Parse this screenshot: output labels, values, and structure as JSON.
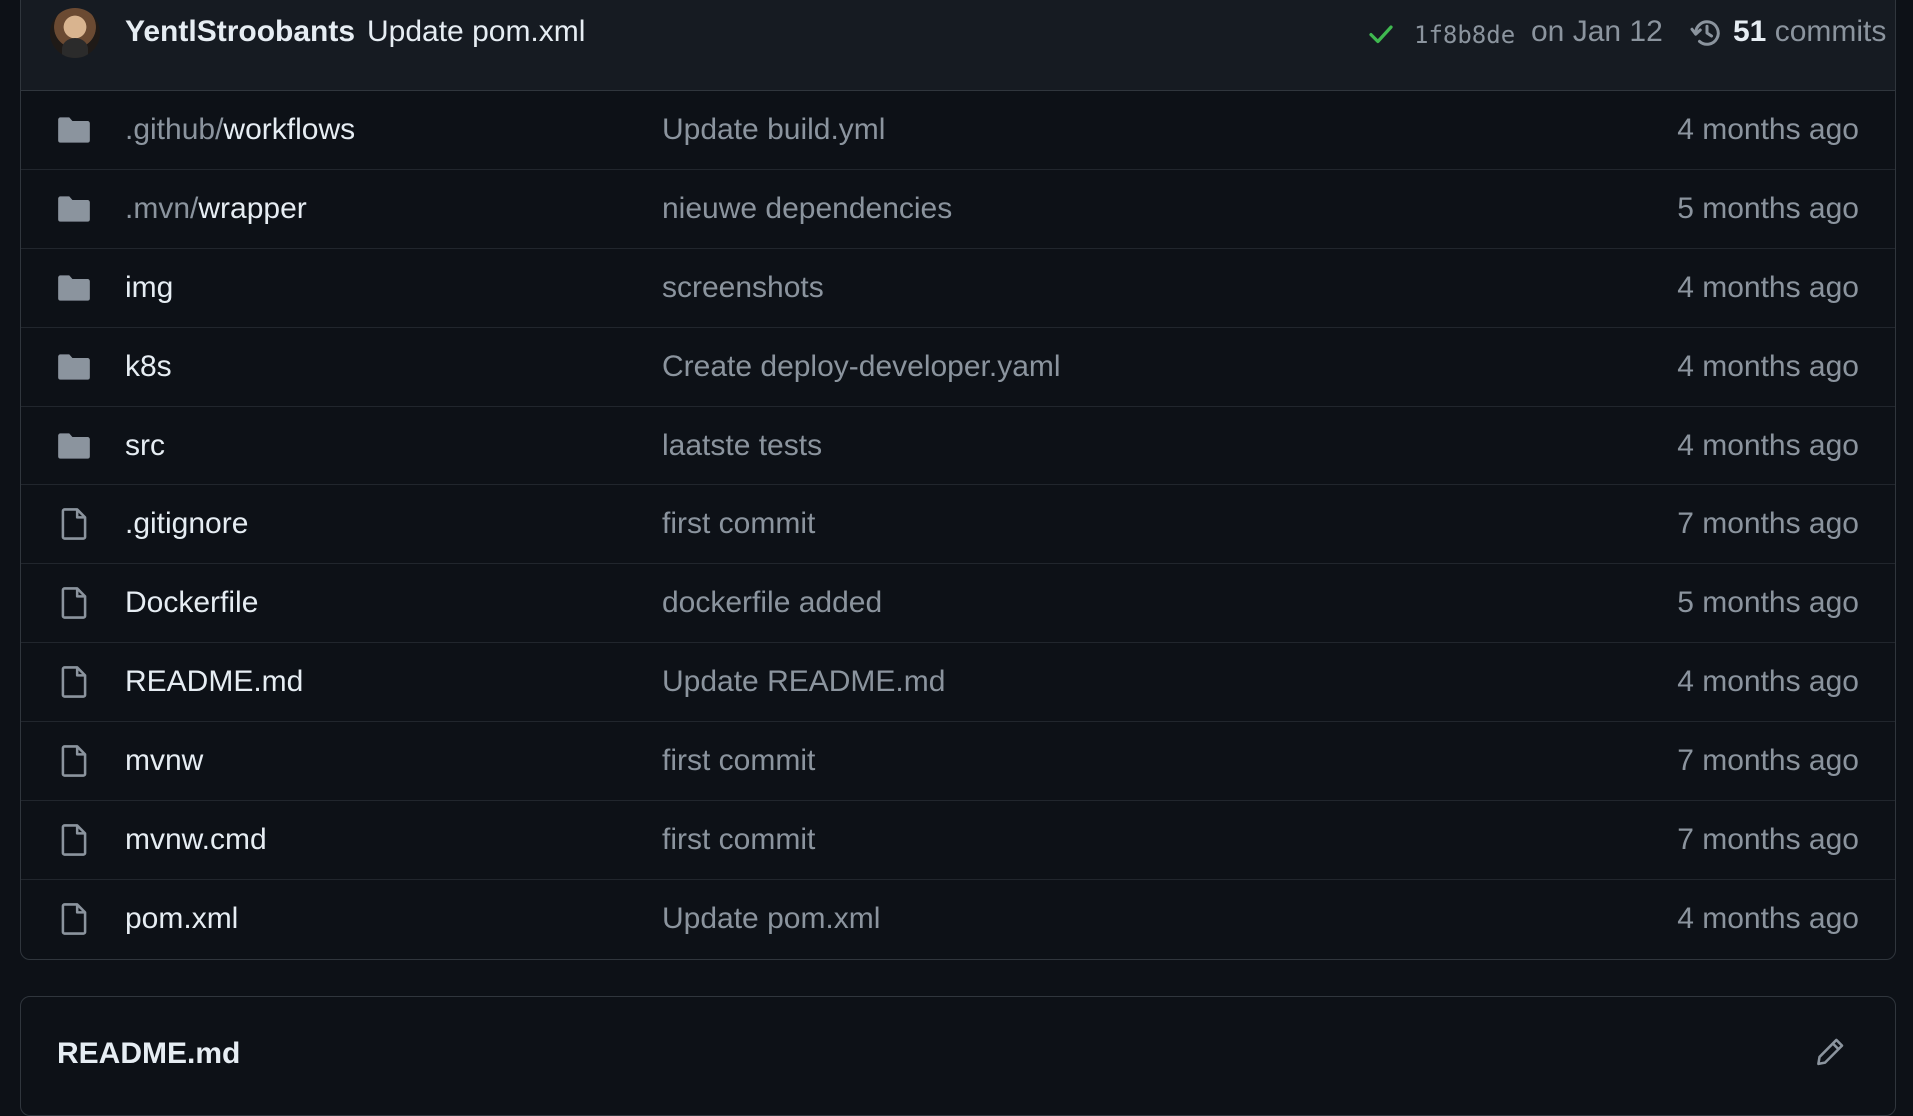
{
  "commit": {
    "author": "YentlStroobants",
    "message": "Update pom.xml",
    "status_icon": "check-icon",
    "sha": "1f8b8de",
    "date": "on Jan 12",
    "history_icon": "history-icon",
    "count": "51",
    "count_label": "commits"
  },
  "files": [
    {
      "type": "folder",
      "prefix": ".github/",
      "name": "workflows",
      "message": "Update build.yml",
      "age": "4 months ago"
    },
    {
      "type": "folder",
      "prefix": ".mvn/",
      "name": "wrapper",
      "message": "nieuwe dependencies",
      "age": "5 months ago"
    },
    {
      "type": "folder",
      "prefix": "",
      "name": "img",
      "message": "screenshots",
      "age": "4 months ago"
    },
    {
      "type": "folder",
      "prefix": "",
      "name": "k8s",
      "message": "Create deploy-developer.yaml",
      "age": "4 months ago"
    },
    {
      "type": "folder",
      "prefix": "",
      "name": "src",
      "message": "laatste tests",
      "age": "4 months ago"
    },
    {
      "type": "file",
      "prefix": "",
      "name": ".gitignore",
      "message": "first commit",
      "age": "7 months ago"
    },
    {
      "type": "file",
      "prefix": "",
      "name": "Dockerfile",
      "message": "dockerfile added",
      "age": "5 months ago"
    },
    {
      "type": "file",
      "prefix": "",
      "name": "README.md",
      "message": "Update README.md",
      "age": "4 months ago"
    },
    {
      "type": "file",
      "prefix": "",
      "name": "mvnw",
      "message": "first commit",
      "age": "7 months ago"
    },
    {
      "type": "file",
      "prefix": "",
      "name": "mvnw.cmd",
      "message": "first commit",
      "age": "7 months ago"
    },
    {
      "type": "file",
      "prefix": "",
      "name": "pom.xml",
      "message": "Update pom.xml",
      "age": "4 months ago"
    }
  ],
  "readme": {
    "title": "README.md",
    "edit_icon": "pencil-icon"
  },
  "colors": {
    "background": "#0d1117",
    "border": "#30363d",
    "text": "#e6edf3",
    "muted": "#8b949e",
    "success": "#3fb950",
    "icon": "#8b949e"
  }
}
